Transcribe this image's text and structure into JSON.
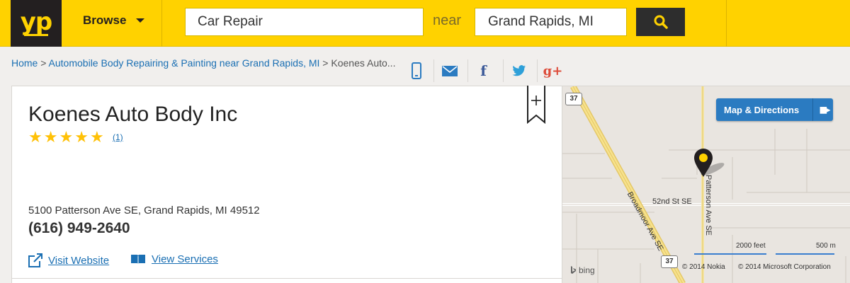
{
  "header": {
    "logo_text": "yp",
    "browse_label": "Browse",
    "search_what": "Car Repair",
    "near_label": "near",
    "search_where": "Grand Rapids, MI"
  },
  "breadcrumb": {
    "home": "Home",
    "sep1": " > ",
    "category": "Automobile Body Repairing & Painting near Grand Rapids, MI",
    "sep2": " > ",
    "current": "Koenes Auto..."
  },
  "share_icons": [
    "mobile-icon",
    "email-icon",
    "facebook-icon",
    "twitter-icon",
    "google-plus-icon"
  ],
  "share_glyphs": {
    "facebook": "f",
    "google_plus": "g+"
  },
  "business": {
    "name": "Koenes Auto Body Inc",
    "stars": 5,
    "rating_count": "(1)",
    "address": "5100 Patterson Ave SE, Grand Rapids, MI 49512",
    "phone": "(616) 949-2640",
    "visit_website_label": "Visit Website",
    "view_services_label": "View Services"
  },
  "map": {
    "directions_label": "Map & Directions",
    "route_37_top": "37",
    "route_37_bottom": "37",
    "street_broadmoor": "Broadmoor Ave SE",
    "street_52nd": "52nd St SE",
    "street_patterson": "Patterson Ave SE",
    "scale_feet": "2000 feet",
    "scale_m": "500 m",
    "brand": "bing",
    "copyright_nokia": "© 2014 Nokia",
    "copyright_ms": "© 2014 Microsoft Corporation"
  },
  "colors": {
    "brand_yellow": "#ffd200",
    "link_blue": "#1a6fb3",
    "star_gold": "#ffc107",
    "map_button": "#2b7bc1"
  }
}
